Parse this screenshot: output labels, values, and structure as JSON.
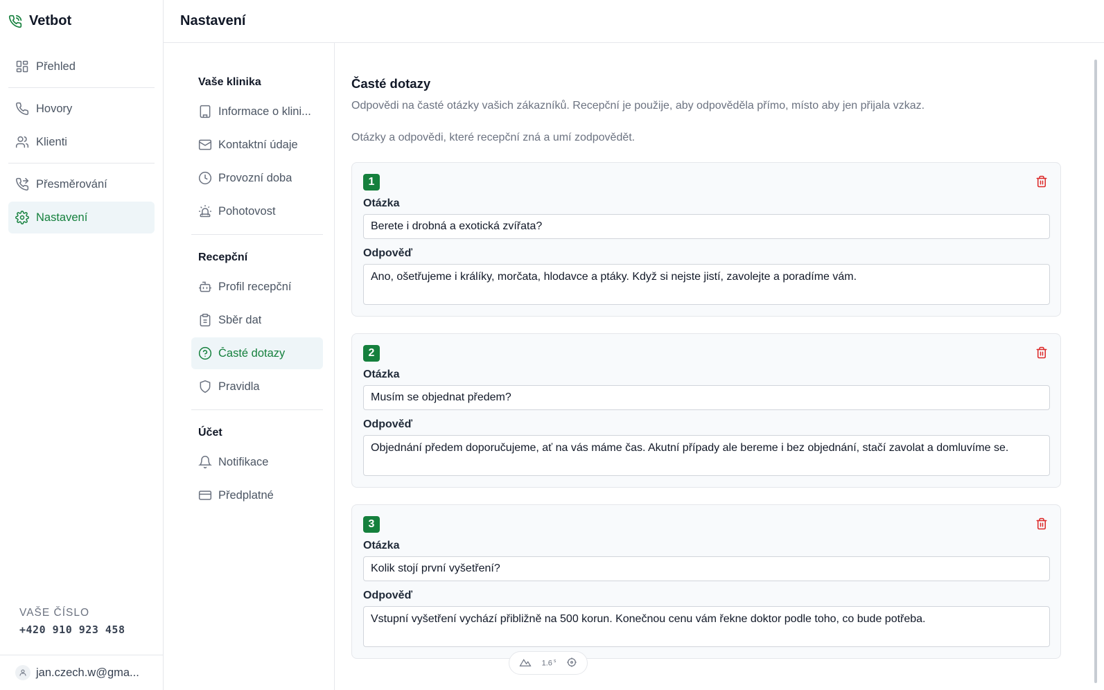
{
  "app": {
    "name": "Vetbot",
    "brand_color": "#15803d"
  },
  "sidebar": {
    "items": [
      {
        "label": "Přehled",
        "icon": "grid-icon"
      },
      {
        "label": "Hovory",
        "icon": "phone-icon"
      },
      {
        "label": "Klienti",
        "icon": "users-icon"
      },
      {
        "label": "Přesměrování",
        "icon": "phone-forward-icon"
      },
      {
        "label": "Nastavení",
        "icon": "gear-icon",
        "active": true
      }
    ],
    "phone_label": "VAŠE ČÍSLO",
    "phone_number": "+420 910 923 458",
    "user_email": "jan.czech.w@gma..."
  },
  "header": {
    "title": "Nastavení"
  },
  "subnav": {
    "groups": [
      {
        "title": "Vaše klinika",
        "items": [
          {
            "label": "Informace o klini...",
            "icon": "building-icon"
          },
          {
            "label": "Kontaktní údaje",
            "icon": "mail-icon"
          },
          {
            "label": "Provozní doba",
            "icon": "clock-icon"
          },
          {
            "label": "Pohotovost",
            "icon": "siren-icon"
          }
        ]
      },
      {
        "title": "Recepční",
        "items": [
          {
            "label": "Profil recepční",
            "icon": "bot-icon"
          },
          {
            "label": "Sběr dat",
            "icon": "clipboard-icon"
          },
          {
            "label": "Časté dotazy",
            "icon": "help-circle-icon",
            "active": true
          },
          {
            "label": "Pravidla",
            "icon": "shield-icon"
          }
        ]
      },
      {
        "title": "Účet",
        "items": [
          {
            "label": "Notifikace",
            "icon": "bell-icon"
          },
          {
            "label": "Předplatné",
            "icon": "credit-card-icon"
          }
        ]
      }
    ]
  },
  "faq": {
    "title": "Časté dotazy",
    "description": "Odpovědi na časté otázky vašich zákazníků. Recepční je použije, aby odpověděla přímo, místo aby jen přijala vzkaz.",
    "subtitle": "Otázky a odpovědi, které recepční zná a umí zodpovědět.",
    "question_label": "Otázka",
    "answer_label": "Odpověď",
    "items": [
      {
        "number": "1",
        "question": "Berete i drobná a exotická zvířata?",
        "answer": "Ano, ošetřujeme i králíky, morčata, hlodavce a ptáky. Když si nejste jistí, zavolejte a poradíme vám."
      },
      {
        "number": "2",
        "question": "Musím se objednat předem?",
        "answer": "Objednání předem doporučujeme, ať na vás máme čas. Akutní případy ale bereme i bez objednání, stačí zavolat a domluvíme se."
      },
      {
        "number": "3",
        "question": "Kolik stojí první vyšetření?",
        "answer": "Vstupní vyšetření vychází přibližně na 500 korun. Konečnou cenu vám řekne doktor podle toho, co bude potřeba."
      }
    ]
  },
  "devtools": {
    "value": "1.6",
    "unit": "s"
  }
}
